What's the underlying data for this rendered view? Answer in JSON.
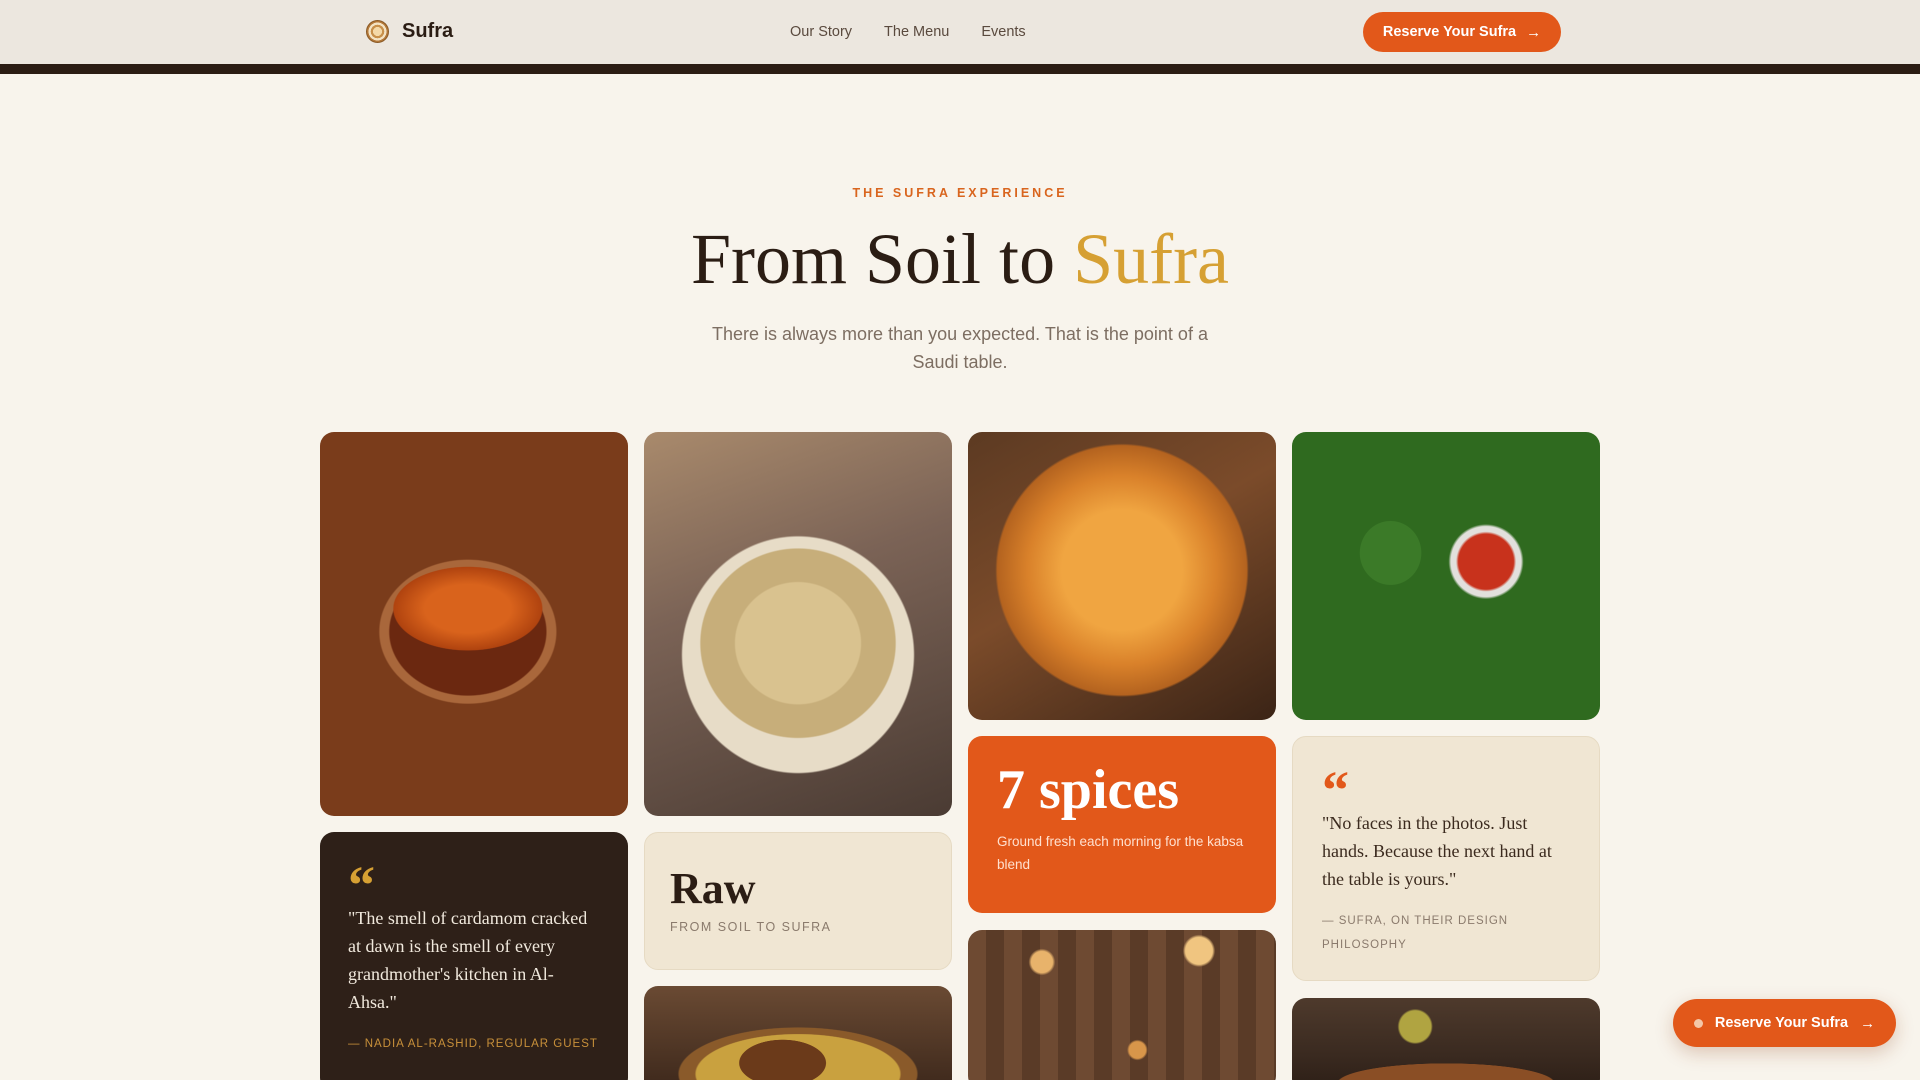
{
  "nav": {
    "brand": "Sufra",
    "links": [
      "Our Story",
      "The Menu",
      "Events"
    ],
    "cta": "Reserve Your Sufra"
  },
  "hero": {
    "eyebrow": "THE SUFRA EXPERIENCE",
    "title_main": "From Soil to ",
    "title_accent": "Sufra",
    "subtitle": "There is always more than you expected. That is the point of a Saudi table."
  },
  "cards": {
    "quote1": {
      "text": "\"The smell of cardamom cracked at dawn is the smell of every grandmother's kitchen in Al-Ahsa.\"",
      "attribution": "— NADIA AL-RASHID, REGULAR GUEST"
    },
    "raw": {
      "title": "Raw",
      "subtitle": "FROM SOIL TO SUFRA"
    },
    "stat": {
      "value": "7 spices",
      "description": "Ground fresh each morning for the kabsa blend"
    },
    "quote2": {
      "text": "\"No faces in the photos. Just hands. Because the next hand at the table is yours.\"",
      "attribution": "— SUFRA, ON THEIR DESIGN PHILOSOPHY"
    }
  },
  "float_cta": "Reserve Your Sufra",
  "colors": {
    "accent": "#e2581a",
    "gold": "#d6a033",
    "dark": "#2b1d14",
    "background": "#f8f4ec"
  }
}
